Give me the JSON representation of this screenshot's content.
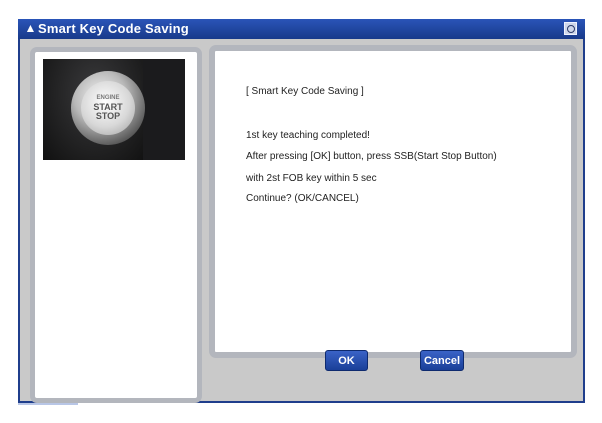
{
  "window": {
    "title": "Smart Key Code Saving",
    "title_icon": "app-icon",
    "close_icon": "close-icon"
  },
  "image": {
    "line1": "ENGINE",
    "line2": "START",
    "line3": "STOP"
  },
  "message": {
    "heading": "[ Smart Key Code Saving ]",
    "lines": [
      "1st key teaching completed!",
      "After pressing [OK] button, press SSB(Start Stop Button)",
      "with 2st FOB key within 5 sec",
      "Continue? (OK/CANCEL)"
    ]
  },
  "buttons": {
    "ok": "OK",
    "cancel": "Cancel"
  },
  "colors": {
    "titlebar": "#1f3e8c",
    "client_bg": "#c9c9c9",
    "button": "#2a52b5"
  }
}
